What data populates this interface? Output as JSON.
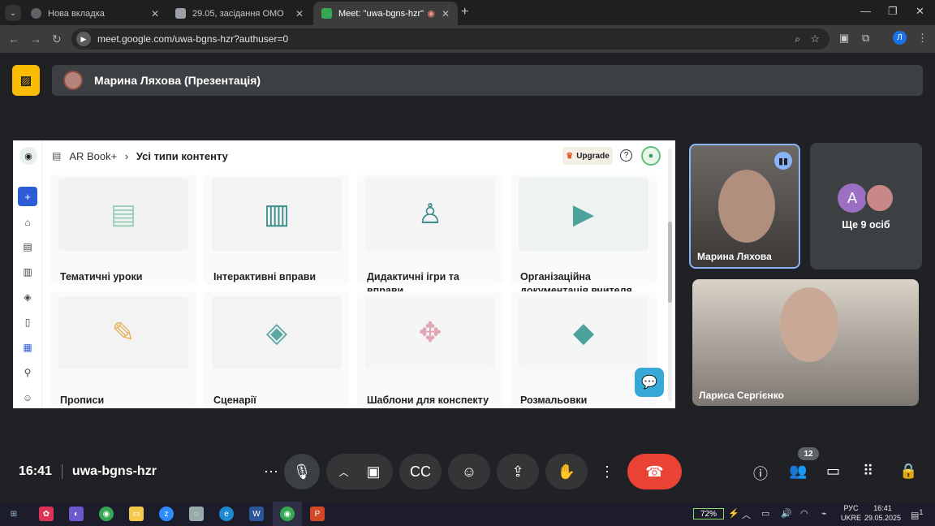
{
  "browser": {
    "tabs": [
      {
        "title": "Нова вкладка"
      },
      {
        "title": "29.05, засідання ОМО"
      },
      {
        "title": "Meet: \"uwa-bgns-hzr\""
      }
    ],
    "url": "meet.google.com/uwa-bgns-hzr?authuser=0",
    "profile_initial": "Л"
  },
  "meet": {
    "presenter_title": "Марина Ляхова (Презентація)",
    "meeting_time": "16:41",
    "meeting_code": "uwa-bgns-hzr",
    "participants_count": "12",
    "colors": {
      "accent": "#8ab4f8",
      "end_call": "#ea4335",
      "present_btn": "#fbbc04"
    }
  },
  "shared_app": {
    "breadcrumb_root": "AR Book+",
    "breadcrumb_sep": "›",
    "breadcrumb_current": "Усі типи контенту",
    "upgrade_label": "Upgrade",
    "help": "?",
    "cards": [
      {
        "label": "Тематичні уроки",
        "icon": "document-icon"
      },
      {
        "label": "Інтерактивні вправи",
        "icon": "books-icon"
      },
      {
        "label": "Дидактичні ігри та вправи",
        "icon": "person-desk-icon"
      },
      {
        "label": "Організаційна документація вчителя",
        "icon": "video-laptop-icon"
      },
      {
        "label": "Прописи",
        "icon": "glasses-icon"
      },
      {
        "label": "Сценарії",
        "icon": "cube-icon"
      },
      {
        "label": "Шаблони для конспекту",
        "icon": "puzzle-icon"
      },
      {
        "label": "Розмальовки",
        "icon": "blocks-icon"
      }
    ]
  },
  "tiles": [
    {
      "name": "Марина Ляхова"
    },
    {
      "initial": "А",
      "more": "Ще 9 осіб"
    },
    {
      "name": "Лариса Сергієнко"
    }
  ],
  "taskbar": {
    "battery": "72%",
    "lang_top": "РУС",
    "lang_bottom": "UKRE",
    "time": "16:41",
    "date": "29.05.2025",
    "notif_count": "1"
  }
}
